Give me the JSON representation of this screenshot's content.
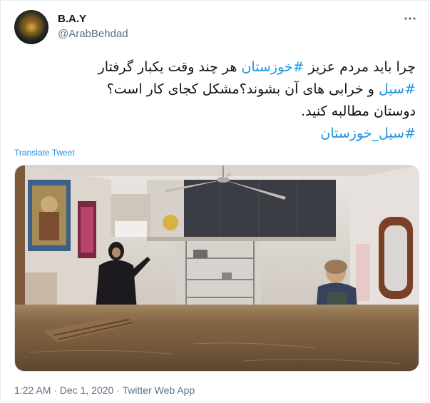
{
  "tweet": {
    "display_name": "B.A.Y",
    "handle": "@ArabBehdad",
    "more_icon": "more-dots-icon",
    "text_line1_pre": "چرا باید مردم عزیز ",
    "text_line1_tag": "#خوزستان",
    "text_line1_post": " هر چند وقت یکبار گرفتار",
    "text_line2_tag": "#سیل",
    "text_line2_post": " و خرابی های آن بشوند؟مشکل کجای کار است؟",
    "text_line3": "دوستان مطالبه کنید.",
    "text_line4_tag": "#سیل_خوزستان",
    "translate_label": "Translate Tweet",
    "timestamp": "1:22 AM · Dec 1, 2020 · ",
    "source": "Twitter Web App"
  },
  "colors": {
    "link": "#1b95e0",
    "secondary_text": "#5b7083",
    "border": "#e6ecf0"
  }
}
